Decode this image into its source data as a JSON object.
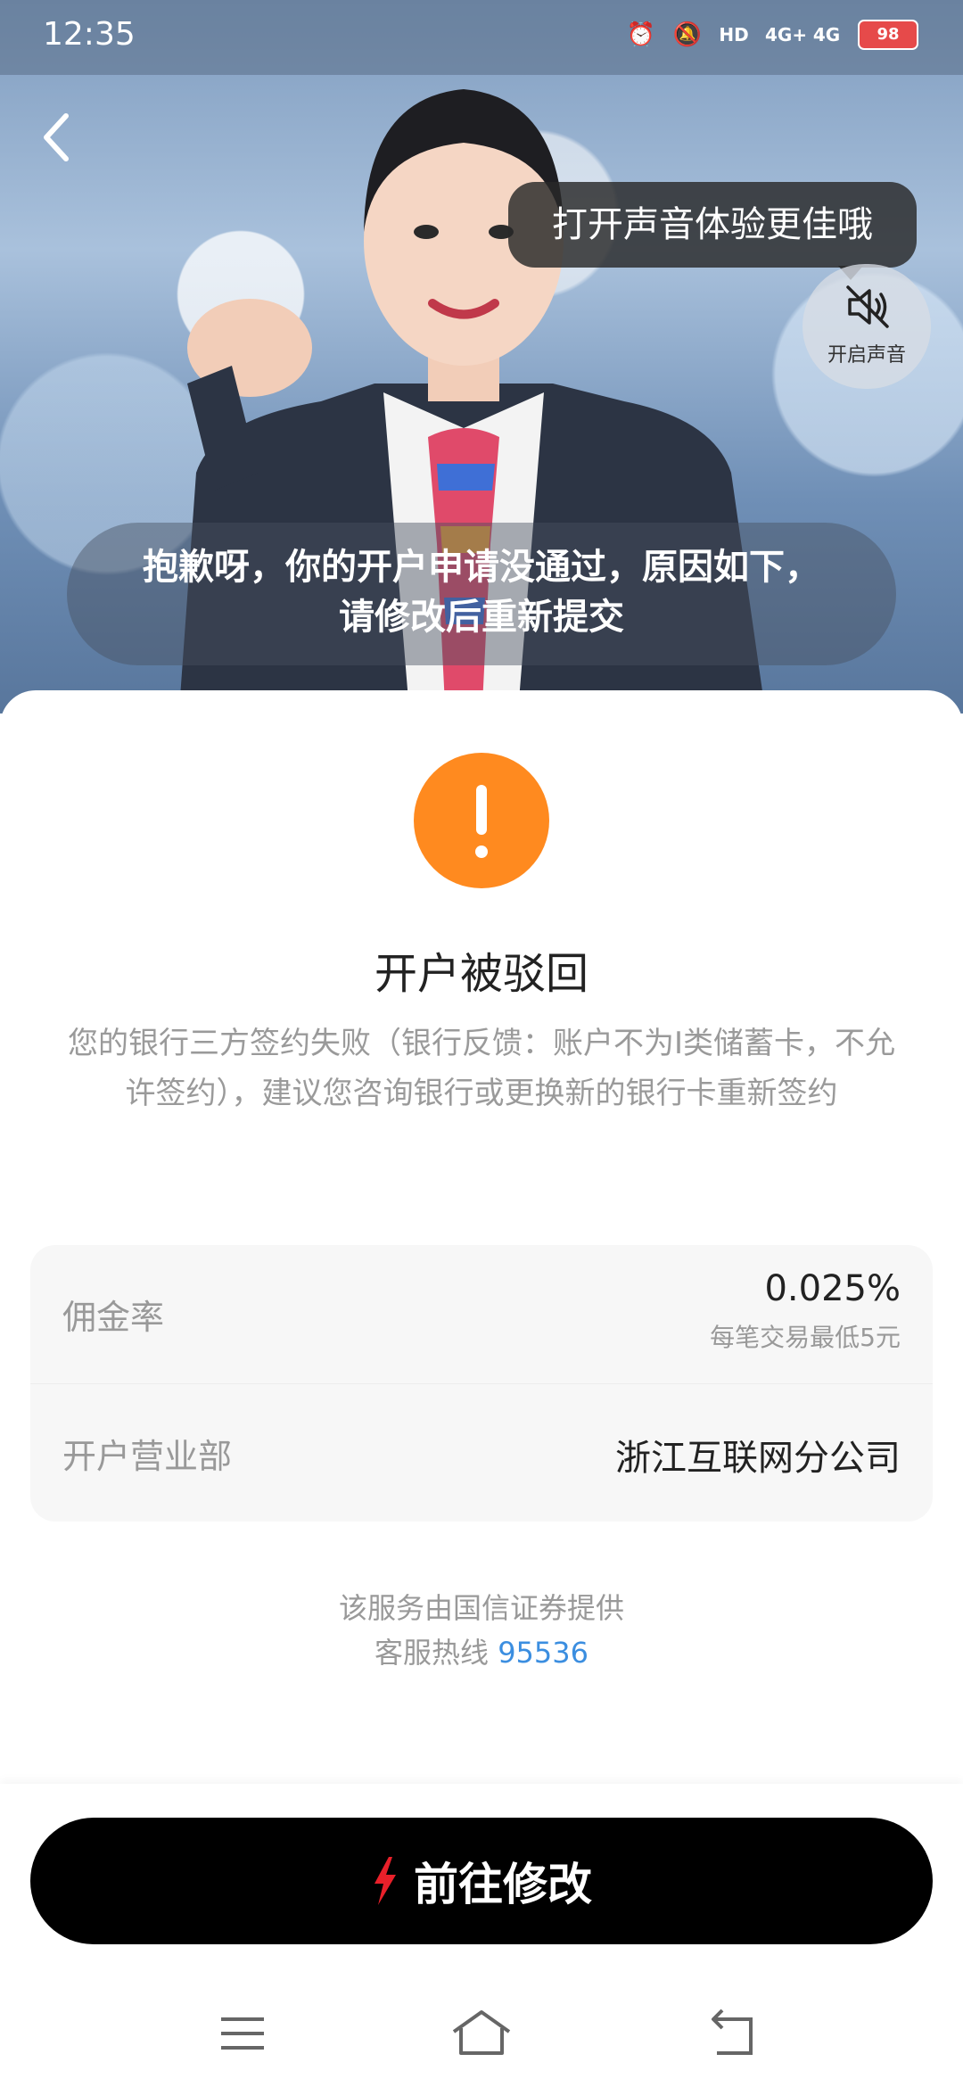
{
  "status_bar": {
    "time": "12:35",
    "icons": [
      "alarm-icon",
      "mute-notification-icon",
      "hd-icon",
      "signal-4g-plus-icon",
      "signal-4g-icon"
    ],
    "hd_label": "HD",
    "net1": "4G+",
    "net2": "4G",
    "battery": "98"
  },
  "hero": {
    "sound_tip": "打开声音体验更佳哦",
    "sound_button_label": "开启声音",
    "subtitle_line1": "抱歉呀，你的开户申请没通过，原因如下，",
    "subtitle_line2": "请修改后重新提交"
  },
  "result": {
    "title": "开户被驳回",
    "description": "您的银行三方签约失败（银行反馈：账户不为I类储蓄卡，不允许签约），建议您咨询银行或更换新的银行卡重新签约"
  },
  "info": {
    "rate_label": "佣金率",
    "rate_value": "0.025%",
    "rate_note": "每笔交易最低5元",
    "branch_label": "开户营业部",
    "branch_value": "浙江互联网分公司"
  },
  "footer": {
    "provider": "该服务由国信证券提供",
    "hotline_label": "客服热线",
    "hotline_number": "95536"
  },
  "cta": {
    "label": "前往修改"
  },
  "colors": {
    "warning": "#ff8a1f",
    "cta_bg": "#000000",
    "hotline": "#3b8ee0",
    "lightning": "#e8202a"
  }
}
